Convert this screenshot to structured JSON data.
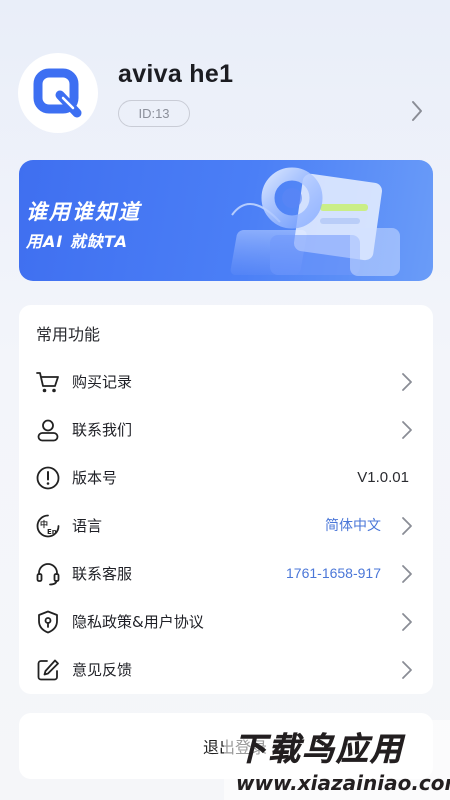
{
  "profile": {
    "username": "aviva he1",
    "id_label": "ID:13",
    "avatar_icon": "app-logo-q-icon",
    "arrow_icon": "chevron-right-icon"
  },
  "banner": {
    "title": "谁用谁知道",
    "subtitle": "用AI 就缺TA",
    "color": "#4576f3"
  },
  "functions": {
    "title": "常用功能",
    "items": [
      {
        "label": "购买记录",
        "icon": "cart-icon",
        "value": "",
        "arrow": true
      },
      {
        "label": "联系我们",
        "icon": "user-icon",
        "value": "",
        "arrow": true
      },
      {
        "label": "版本号",
        "icon": "info-icon",
        "value": "V1.0.01",
        "arrow": false
      },
      {
        "label": "语言",
        "icon": "language-icon",
        "value": "简体中文",
        "arrow": true
      },
      {
        "label": "联系客服",
        "icon": "headset-icon",
        "value": "1761-1658-917",
        "arrow": true
      },
      {
        "label": "隐私政策&用户协议",
        "icon": "shield-icon",
        "value": "",
        "arrow": true
      },
      {
        "label": "意见反馈",
        "icon": "edit-icon",
        "value": "",
        "arrow": true
      }
    ]
  },
  "logout": {
    "label": "退出登录"
  },
  "watermark": {
    "title": "下载鸟应用",
    "url": "www.xiazainiao.com"
  },
  "colors": {
    "accent_blue": "#4b77d8",
    "banner_blue": "#4576f3"
  }
}
